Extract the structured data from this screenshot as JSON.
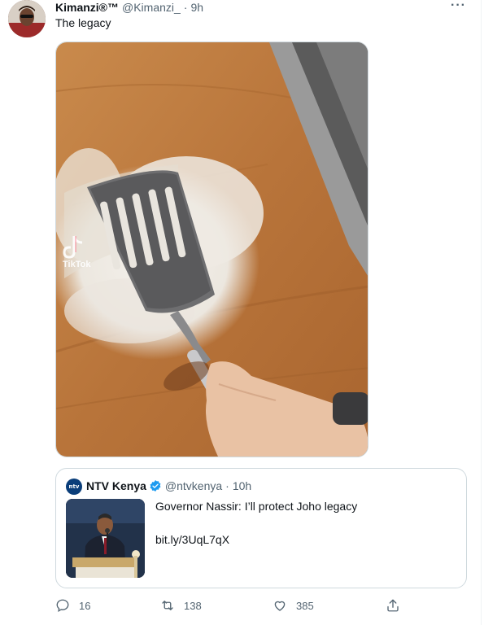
{
  "tweet": {
    "author_name": "Kimanzi®™",
    "author_handle": "@Kimanzi_",
    "separator": "·",
    "time": "9h",
    "text": "The legacy",
    "more_icon": "more-icon",
    "more_label": "···",
    "media": {
      "watermark": "TikTok"
    }
  },
  "quote": {
    "avatar_label": "ntv",
    "author_name": "NTV Kenya",
    "verified_icon": "verified-badge-icon",
    "author_handle": "@ntvkenya",
    "separator": "·",
    "time": "10h",
    "text": "Governor Nassir: I’ll protect Joho legacy",
    "link": "bit.ly/3UqL7qX"
  },
  "actions": {
    "reply_count": "16",
    "retweet_count": "138",
    "like_count": "385"
  },
  "colors": {
    "accent": "#1d9bf0",
    "secondary_text": "#536471",
    "border": "#cfd9de"
  }
}
